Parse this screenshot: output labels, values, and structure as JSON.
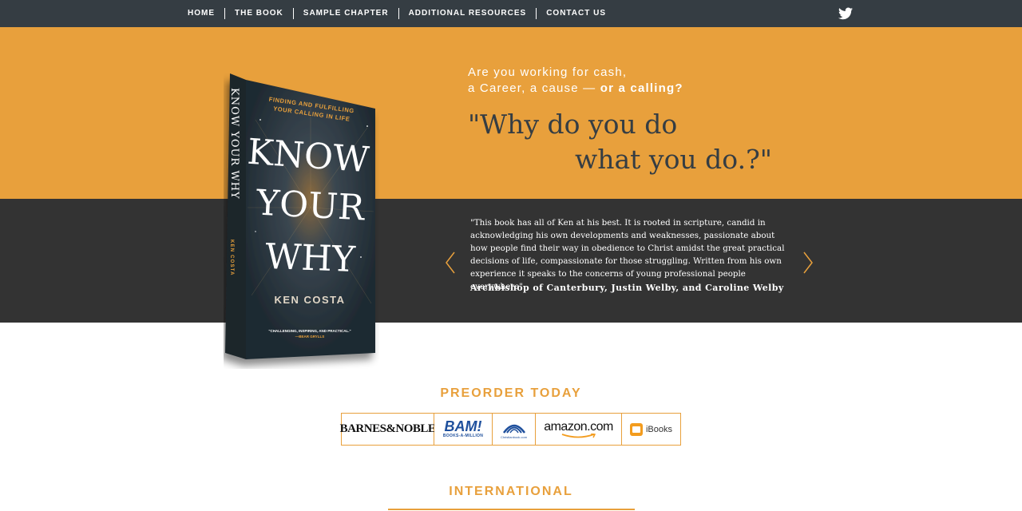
{
  "nav": {
    "items": [
      {
        "label": "HOME"
      },
      {
        "label": "THE BOOK"
      },
      {
        "label": "SAMPLE CHAPTER"
      },
      {
        "label": "ADDITIONAL RESOURCES"
      },
      {
        "label": "CONTACT US"
      }
    ],
    "social_icon": "twitter-icon"
  },
  "hero": {
    "tagline_line1": "Are you working for cash,",
    "tagline_line2_prefix": "a Career, a cause — ",
    "tagline_line2_bold": "or a calling?",
    "question_line1": "\"Why do you do",
    "question_line2": "what you do.?\""
  },
  "book": {
    "subtitle_line1": "FINDING AND FULFILLING",
    "subtitle_line2": "YOUR CALLING IN LIFE",
    "title_line1": "KNOW",
    "title_line2": "YOUR",
    "title_line3": "WHY",
    "author": "KEN COSTA",
    "blurb_line1": "\"CHALLENGING, INSPIRING, AND PRACTICAL.\"",
    "blurb_line2": "—BEAR GRYLLS",
    "spine_title": "KNOW YOUR WHY",
    "spine_author": "KEN COSTA"
  },
  "testimonial": {
    "quote": "\"This book has all of Ken at his best. It is rooted in scripture, candid in acknowledging his own developments and weaknesses, passionate about how people find their way in obedience to Christ amidst the great practical decisions of life, compassionate for those struggling. Written from his own experience it speaks to the concerns of young professional people everywhere\".",
    "attribution": "Archbishop of Canterbury, Justin Welby, and Caroline Welby"
  },
  "preorder": {
    "heading": "PREORDER TODAY",
    "retailers": {
      "barnes": "BARNES&NOBLE",
      "bam": "BAM!",
      "bam_sub": "BOOKS-A-MILLION",
      "christianbook": "Christianbook.com",
      "amazon": "amazon.com",
      "ibooks": "iBooks"
    }
  },
  "international": {
    "heading": "INTERNATIONAL"
  },
  "colors": {
    "accent": "#e8a03c",
    "nav_bg": "#353d43",
    "dark_band": "#333333",
    "book_cover": "#2a353d"
  }
}
